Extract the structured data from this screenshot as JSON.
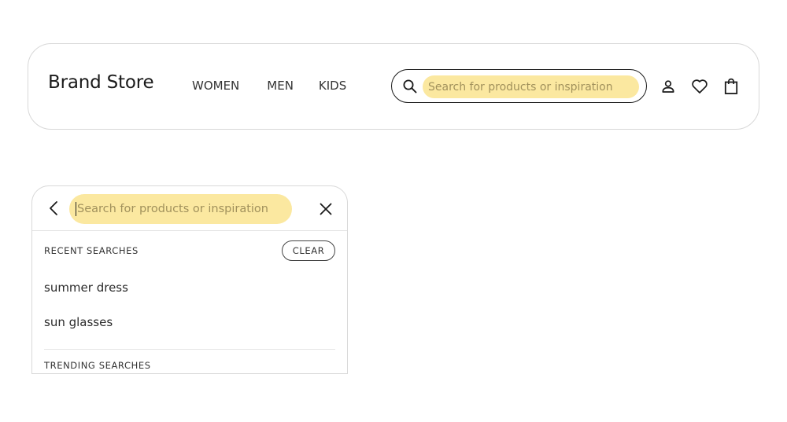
{
  "header": {
    "brand": "Brand Store",
    "nav": [
      "WOMEN",
      "MEN",
      "KIDS"
    ],
    "search": {
      "placeholder": "Search for products or inspiration",
      "icon": "search-icon"
    },
    "icons": [
      "user-icon",
      "heart-icon",
      "shopping-bag-icon"
    ]
  },
  "search_panel": {
    "placeholder": "Search for products or inspiration",
    "back_icon": "chevron-left-icon",
    "close_icon": "close-icon",
    "recent_label": "RECENT SEARCHES",
    "clear_label": "CLEAR",
    "recent_items": [
      "summer dress",
      "sun glasses"
    ],
    "trending_label": "TRENDING SEARCHES"
  },
  "colors": {
    "highlight": "#fbe8a0",
    "border": "#d8d8d8",
    "text": "#222222"
  }
}
